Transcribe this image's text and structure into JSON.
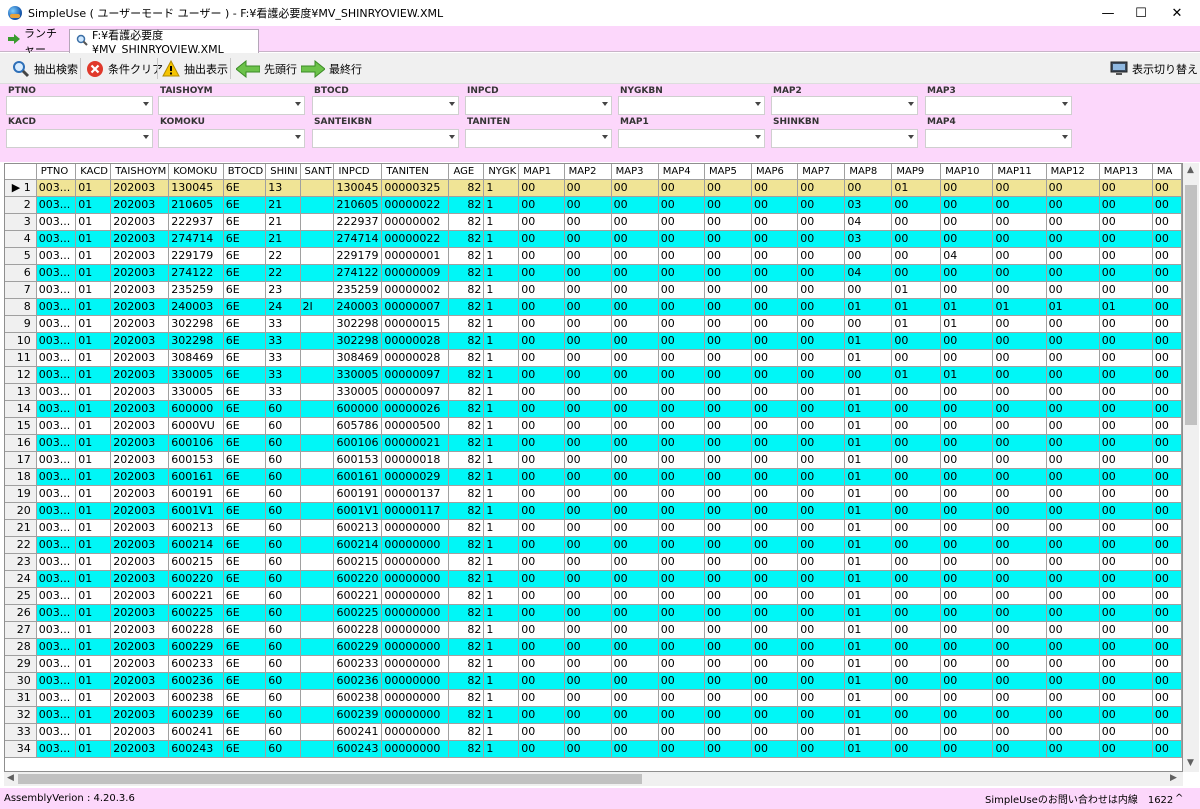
{
  "window": {
    "title": "SimpleUse ( ユーザーモード ユーザー ) - F:¥看護必要度¥MV_SHINRYOVIEW.XML",
    "minimize": "—",
    "maximize": "☐",
    "close": "✕"
  },
  "tabs": [
    {
      "label": "ランチャー",
      "icon": "arrow-right-icon"
    },
    {
      "label": "F:¥看護必要度¥MV_SHINRYOVIEW.XML",
      "icon": "search-icon"
    }
  ],
  "toolbar": {
    "extract_search": "抽出検索",
    "clear_conditions": "条件クリア",
    "show_extract": "抽出表示",
    "first_row": "先頭行",
    "last_row": "最終行",
    "switch_view": "表示切り替え"
  },
  "filters": {
    "row1": [
      "PTNO",
      "TAISHOYM",
      "BTOCD",
      "INPCD",
      "NYGKBN",
      "MAP2",
      "MAP3"
    ],
    "row2": [
      "KACD",
      "KOMOKU",
      "SANTEIKBN",
      "TANITEN",
      "MAP1",
      "SHINKBN",
      "MAP4"
    ]
  },
  "grid": {
    "columns": [
      "PTNO",
      "KACD",
      "TAISHOYM",
      "KOMOKU",
      "BTOCD",
      "SHINI",
      "SANT",
      "INPCD",
      "TANITEN",
      "AGE",
      "NYGK",
      "MAP1",
      "MAP2",
      "MAP3",
      "MAP4",
      "MAP5",
      "MAP6",
      "MAP7",
      "MAP8",
      "MAP9",
      "MAP10",
      "MAP11",
      "MAP12",
      "MAP13",
      "MA"
    ],
    "selected_indicator": "▶",
    "rows": [
      [
        "003...",
        "01",
        "202003",
        "130045",
        "6E",
        "13",
        "",
        "130045",
        "00000325",
        "82",
        "1",
        "00",
        "00",
        "00",
        "00",
        "00",
        "00",
        "00",
        "00",
        "01",
        "00",
        "00",
        "00",
        "00",
        "00"
      ],
      [
        "003...",
        "01",
        "202003",
        "210605",
        "6E",
        "21",
        "",
        "210605",
        "00000022",
        "82",
        "1",
        "00",
        "00",
        "00",
        "00",
        "00",
        "00",
        "00",
        "03",
        "00",
        "00",
        "00",
        "00",
        "00",
        "00"
      ],
      [
        "003...",
        "01",
        "202003",
        "222937",
        "6E",
        "21",
        "",
        "222937",
        "00000002",
        "82",
        "1",
        "00",
        "00",
        "00",
        "00",
        "00",
        "00",
        "00",
        "04",
        "00",
        "00",
        "00",
        "00",
        "00",
        "00"
      ],
      [
        "003...",
        "01",
        "202003",
        "274714",
        "6E",
        "21",
        "",
        "274714",
        "00000022",
        "82",
        "1",
        "00",
        "00",
        "00",
        "00",
        "00",
        "00",
        "00",
        "03",
        "00",
        "00",
        "00",
        "00",
        "00",
        "00"
      ],
      [
        "003...",
        "01",
        "202003",
        "229179",
        "6E",
        "22",
        "",
        "229179",
        "00000001",
        "82",
        "1",
        "00",
        "00",
        "00",
        "00",
        "00",
        "00",
        "00",
        "00",
        "00",
        "04",
        "00",
        "00",
        "00",
        "00"
      ],
      [
        "003...",
        "01",
        "202003",
        "274122",
        "6E",
        "22",
        "",
        "274122",
        "00000009",
        "82",
        "1",
        "00",
        "00",
        "00",
        "00",
        "00",
        "00",
        "00",
        "04",
        "00",
        "00",
        "00",
        "00",
        "00",
        "00"
      ],
      [
        "003...",
        "01",
        "202003",
        "235259",
        "6E",
        "23",
        "",
        "235259",
        "00000002",
        "82",
        "1",
        "00",
        "00",
        "00",
        "00",
        "00",
        "00",
        "00",
        "00",
        "01",
        "00",
        "00",
        "00",
        "00",
        "00"
      ],
      [
        "003...",
        "01",
        "202003",
        "240003",
        "6E",
        "24",
        "2I",
        "240003",
        "00000007",
        "82",
        "1",
        "00",
        "00",
        "00",
        "00",
        "00",
        "00",
        "00",
        "01",
        "01",
        "01",
        "01",
        "01",
        "01",
        "00"
      ],
      [
        "003...",
        "01",
        "202003",
        "302298",
        "6E",
        "33",
        "",
        "302298",
        "00000015",
        "82",
        "1",
        "00",
        "00",
        "00",
        "00",
        "00",
        "00",
        "00",
        "00",
        "01",
        "01",
        "00",
        "00",
        "00",
        "00"
      ],
      [
        "003...",
        "01",
        "202003",
        "302298",
        "6E",
        "33",
        "",
        "302298",
        "00000028",
        "82",
        "1",
        "00",
        "00",
        "00",
        "00",
        "00",
        "00",
        "00",
        "01",
        "00",
        "00",
        "00",
        "00",
        "00",
        "00"
      ],
      [
        "003...",
        "01",
        "202003",
        "308469",
        "6E",
        "33",
        "",
        "308469",
        "00000028",
        "82",
        "1",
        "00",
        "00",
        "00",
        "00",
        "00",
        "00",
        "00",
        "01",
        "00",
        "00",
        "00",
        "00",
        "00",
        "00"
      ],
      [
        "003...",
        "01",
        "202003",
        "330005",
        "6E",
        "33",
        "",
        "330005",
        "00000097",
        "82",
        "1",
        "00",
        "00",
        "00",
        "00",
        "00",
        "00",
        "00",
        "00",
        "01",
        "01",
        "00",
        "00",
        "00",
        "00"
      ],
      [
        "003...",
        "01",
        "202003",
        "330005",
        "6E",
        "33",
        "",
        "330005",
        "00000097",
        "82",
        "1",
        "00",
        "00",
        "00",
        "00",
        "00",
        "00",
        "00",
        "01",
        "00",
        "00",
        "00",
        "00",
        "00",
        "00"
      ],
      [
        "003...",
        "01",
        "202003",
        "600000",
        "6E",
        "60",
        "",
        "600000",
        "00000026",
        "82",
        "1",
        "00",
        "00",
        "00",
        "00",
        "00",
        "00",
        "00",
        "01",
        "00",
        "00",
        "00",
        "00",
        "00",
        "00"
      ],
      [
        "003...",
        "01",
        "202003",
        "6000VU",
        "6E",
        "60",
        "",
        "605786",
        "00000500",
        "82",
        "1",
        "00",
        "00",
        "00",
        "00",
        "00",
        "00",
        "00",
        "01",
        "00",
        "00",
        "00",
        "00",
        "00",
        "00"
      ],
      [
        "003...",
        "01",
        "202003",
        "600106",
        "6E",
        "60",
        "",
        "600106",
        "00000021",
        "82",
        "1",
        "00",
        "00",
        "00",
        "00",
        "00",
        "00",
        "00",
        "01",
        "00",
        "00",
        "00",
        "00",
        "00",
        "00"
      ],
      [
        "003...",
        "01",
        "202003",
        "600153",
        "6E",
        "60",
        "",
        "600153",
        "00000018",
        "82",
        "1",
        "00",
        "00",
        "00",
        "00",
        "00",
        "00",
        "00",
        "01",
        "00",
        "00",
        "00",
        "00",
        "00",
        "00"
      ],
      [
        "003...",
        "01",
        "202003",
        "600161",
        "6E",
        "60",
        "",
        "600161",
        "00000029",
        "82",
        "1",
        "00",
        "00",
        "00",
        "00",
        "00",
        "00",
        "00",
        "01",
        "00",
        "00",
        "00",
        "00",
        "00",
        "00"
      ],
      [
        "003...",
        "01",
        "202003",
        "600191",
        "6E",
        "60",
        "",
        "600191",
        "00000137",
        "82",
        "1",
        "00",
        "00",
        "00",
        "00",
        "00",
        "00",
        "00",
        "01",
        "00",
        "00",
        "00",
        "00",
        "00",
        "00"
      ],
      [
        "003...",
        "01",
        "202003",
        "6001V1",
        "6E",
        "60",
        "",
        "6001V1",
        "00000117",
        "82",
        "1",
        "00",
        "00",
        "00",
        "00",
        "00",
        "00",
        "00",
        "01",
        "00",
        "00",
        "00",
        "00",
        "00",
        "00"
      ],
      [
        "003...",
        "01",
        "202003",
        "600213",
        "6E",
        "60",
        "",
        "600213",
        "00000000",
        "82",
        "1",
        "00",
        "00",
        "00",
        "00",
        "00",
        "00",
        "00",
        "01",
        "00",
        "00",
        "00",
        "00",
        "00",
        "00"
      ],
      [
        "003...",
        "01",
        "202003",
        "600214",
        "6E",
        "60",
        "",
        "600214",
        "00000000",
        "82",
        "1",
        "00",
        "00",
        "00",
        "00",
        "00",
        "00",
        "00",
        "01",
        "00",
        "00",
        "00",
        "00",
        "00",
        "00"
      ],
      [
        "003...",
        "01",
        "202003",
        "600215",
        "6E",
        "60",
        "",
        "600215",
        "00000000",
        "82",
        "1",
        "00",
        "00",
        "00",
        "00",
        "00",
        "00",
        "00",
        "01",
        "00",
        "00",
        "00",
        "00",
        "00",
        "00"
      ],
      [
        "003...",
        "01",
        "202003",
        "600220",
        "6E",
        "60",
        "",
        "600220",
        "00000000",
        "82",
        "1",
        "00",
        "00",
        "00",
        "00",
        "00",
        "00",
        "00",
        "01",
        "00",
        "00",
        "00",
        "00",
        "00",
        "00"
      ],
      [
        "003...",
        "01",
        "202003",
        "600221",
        "6E",
        "60",
        "",
        "600221",
        "00000000",
        "82",
        "1",
        "00",
        "00",
        "00",
        "00",
        "00",
        "00",
        "00",
        "01",
        "00",
        "00",
        "00",
        "00",
        "00",
        "00"
      ],
      [
        "003...",
        "01",
        "202003",
        "600225",
        "6E",
        "60",
        "",
        "600225",
        "00000000",
        "82",
        "1",
        "00",
        "00",
        "00",
        "00",
        "00",
        "00",
        "00",
        "01",
        "00",
        "00",
        "00",
        "00",
        "00",
        "00"
      ],
      [
        "003...",
        "01",
        "202003",
        "600228",
        "6E",
        "60",
        "",
        "600228",
        "00000000",
        "82",
        "1",
        "00",
        "00",
        "00",
        "00",
        "00",
        "00",
        "00",
        "01",
        "00",
        "00",
        "00",
        "00",
        "00",
        "00"
      ],
      [
        "003...",
        "01",
        "202003",
        "600229",
        "6E",
        "60",
        "",
        "600229",
        "00000000",
        "82",
        "1",
        "00",
        "00",
        "00",
        "00",
        "00",
        "00",
        "00",
        "01",
        "00",
        "00",
        "00",
        "00",
        "00",
        "00"
      ],
      [
        "003...",
        "01",
        "202003",
        "600233",
        "6E",
        "60",
        "",
        "600233",
        "00000000",
        "82",
        "1",
        "00",
        "00",
        "00",
        "00",
        "00",
        "00",
        "00",
        "01",
        "00",
        "00",
        "00",
        "00",
        "00",
        "00"
      ],
      [
        "003...",
        "01",
        "202003",
        "600236",
        "6E",
        "60",
        "",
        "600236",
        "00000000",
        "82",
        "1",
        "00",
        "00",
        "00",
        "00",
        "00",
        "00",
        "00",
        "01",
        "00",
        "00",
        "00",
        "00",
        "00",
        "00"
      ],
      [
        "003...",
        "01",
        "202003",
        "600238",
        "6E",
        "60",
        "",
        "600238",
        "00000000",
        "82",
        "1",
        "00",
        "00",
        "00",
        "00",
        "00",
        "00",
        "00",
        "01",
        "00",
        "00",
        "00",
        "00",
        "00",
        "00"
      ],
      [
        "003...",
        "01",
        "202003",
        "600239",
        "6E",
        "60",
        "",
        "600239",
        "00000000",
        "82",
        "1",
        "00",
        "00",
        "00",
        "00",
        "00",
        "00",
        "00",
        "01",
        "00",
        "00",
        "00",
        "00",
        "00",
        "00"
      ],
      [
        "003...",
        "01",
        "202003",
        "600241",
        "6E",
        "60",
        "",
        "600241",
        "00000000",
        "82",
        "1",
        "00",
        "00",
        "00",
        "00",
        "00",
        "00",
        "00",
        "01",
        "00",
        "00",
        "00",
        "00",
        "00",
        "00"
      ],
      [
        "003...",
        "01",
        "202003",
        "600243",
        "6E",
        "60",
        "",
        "600243",
        "00000000",
        "82",
        "1",
        "00",
        "00",
        "00",
        "00",
        "00",
        "00",
        "00",
        "01",
        "00",
        "00",
        "00",
        "00",
        "00",
        "00"
      ]
    ]
  },
  "status": {
    "version": "AssemblyVerion : 4.20.3.6",
    "contact": "SimpleUseのお問い合わせは内線　1622",
    "caret": "^"
  },
  "colors": {
    "alt_row": "#00f7f7",
    "selected_row": "#f0e496",
    "pink": "#fcd7fb"
  }
}
